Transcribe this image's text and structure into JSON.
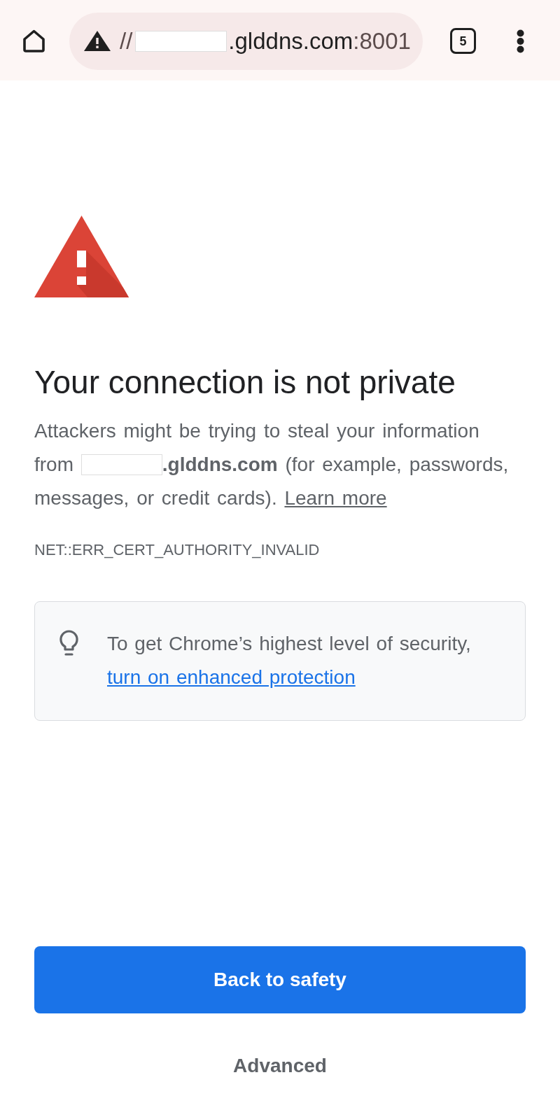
{
  "toolbar": {
    "address": {
      "secure": false,
      "prefix": "//",
      "host": ".glddns.com",
      "port": ":8001"
    },
    "tab_count": "5"
  },
  "interstitial": {
    "heading": "Your connection is not private",
    "description": {
      "before": "Attackers might be trying to steal your information from",
      "after": "**.glddns.com** (for example, passwords, messages, or credit cards).",
      "link": "Learn more"
    },
    "error_code": "NET::ERR_CERT_AUTHORITY_INVALID",
    "tip": {
      "text": "To get Chrome’s highest level of security,",
      "link": "turn on enhanced protection"
    },
    "buttons": [
      {
        "kind": "primary",
        "label": "Back to safety"
      },
      {
        "kind": "secondary",
        "label": "Advanced"
      }
    ]
  }
}
